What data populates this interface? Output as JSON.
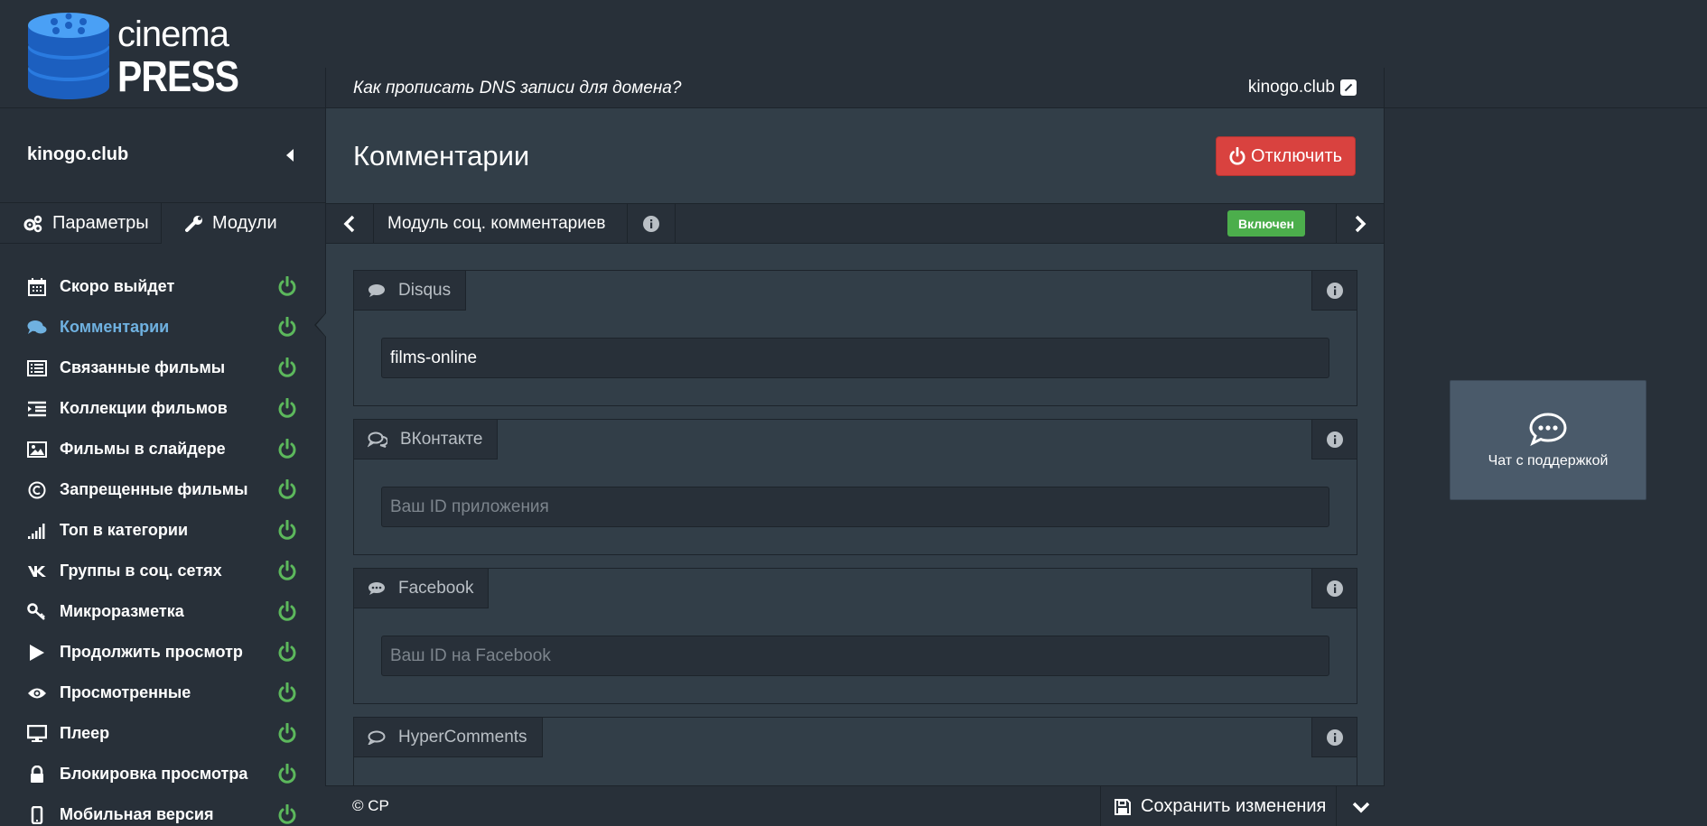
{
  "brand": {
    "line1": "cinema",
    "line2": "PRESS"
  },
  "sidebar": {
    "site_name": "kinogo.club",
    "tabs": [
      {
        "label": "Параметры",
        "icon": "gears-icon"
      },
      {
        "label": "Модули",
        "icon": "wrench-icon"
      }
    ],
    "items": [
      {
        "label": "Скоро выйдет",
        "icon": "calendar-icon",
        "enabled": true
      },
      {
        "label": "Комментарии",
        "icon": "comments-icon",
        "enabled": true,
        "active": true
      },
      {
        "label": "Связанные фильмы",
        "icon": "list-icon",
        "enabled": true
      },
      {
        "label": "Коллекции фильмов",
        "icon": "indent-list-icon",
        "enabled": true
      },
      {
        "label": "Фильмы в слайдере",
        "icon": "image-icon",
        "enabled": true
      },
      {
        "label": "Запрещенные фильмы",
        "icon": "copyright-icon",
        "enabled": true
      },
      {
        "label": "Топ в категории",
        "icon": "signal-icon",
        "enabled": true
      },
      {
        "label": "Группы в соц. сетях",
        "icon": "vk-icon",
        "enabled": true
      },
      {
        "label": "Микроразметка",
        "icon": "key-icon",
        "enabled": true
      },
      {
        "label": "Продолжить просмотр",
        "icon": "play-icon",
        "enabled": true
      },
      {
        "label": "Просмотренные",
        "icon": "eye-icon",
        "enabled": true
      },
      {
        "label": "Плеер",
        "icon": "monitor-icon",
        "enabled": true
      },
      {
        "label": "Блокировка просмотра",
        "icon": "lock-icon",
        "enabled": true
      },
      {
        "label": "Мобильная версия",
        "icon": "mobile-icon",
        "enabled": true
      }
    ]
  },
  "header": {
    "dns_link": "Как прописать DNS записи для домена?",
    "site_link": "kinogo.club"
  },
  "page": {
    "title": "Комментарии",
    "disable_button": "Отключить"
  },
  "module_bar": {
    "name": "Модуль соц. комментариев",
    "status": "Включен"
  },
  "services": [
    {
      "name": "Disqus",
      "icon": "comment-icon",
      "value": "films-online",
      "placeholder": ""
    },
    {
      "name": "ВКонтакте",
      "icon": "comments-outline-icon",
      "value": "",
      "placeholder": "Ваш ID приложения"
    },
    {
      "name": "Facebook",
      "icon": "commenting-icon",
      "value": "",
      "placeholder": "Ваш ID на Facebook"
    },
    {
      "name": "HyperComments",
      "icon": "comment-outline-icon",
      "value": "",
      "placeholder": ""
    }
  ],
  "footer": {
    "copyright": "© CP",
    "save_label": "Сохранить изменения"
  },
  "chat": {
    "label": "Чат с поддержкой"
  },
  "colors": {
    "background": "#283039",
    "panel": "#323e48",
    "accent_active": "#6fb1e0",
    "power_green": "#5cb85c",
    "danger": "#d9423f",
    "success_badge": "#4cae4c",
    "chat_bg": "#4a5a6a"
  }
}
